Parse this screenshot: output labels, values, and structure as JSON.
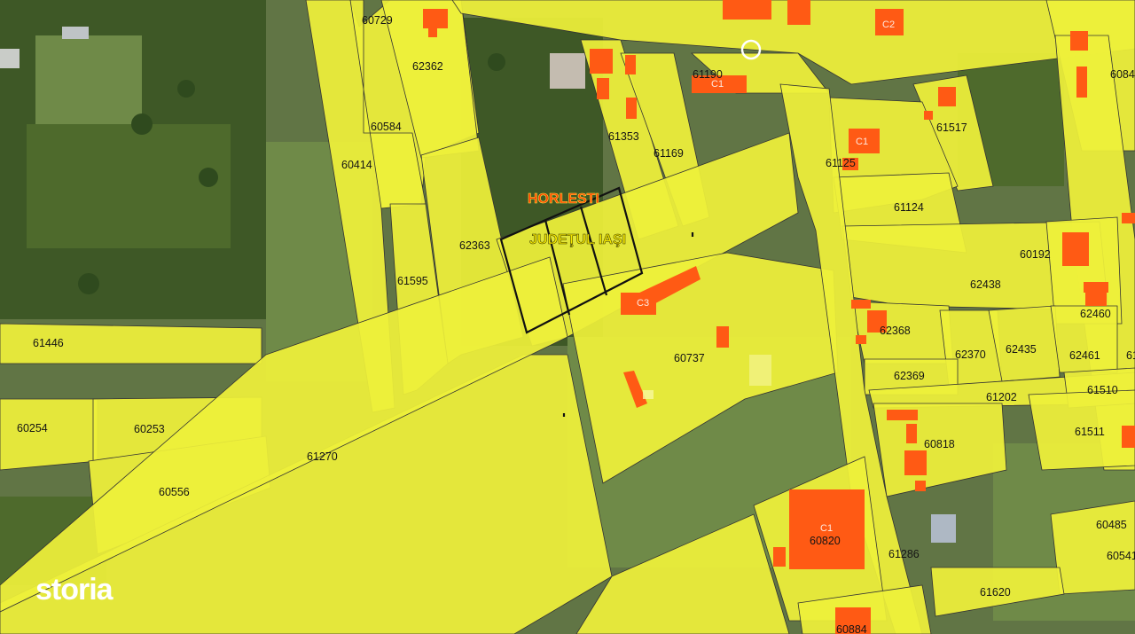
{
  "map": {
    "town_label": "HORLESTI",
    "county_label": "JUDEŢUL IAŞI",
    "parcels": [
      "60729",
      "62362",
      "60584",
      "60414",
      "61353",
      "61169",
      "61190",
      "61517",
      "61125",
      "61124",
      "62363",
      "61595",
      "61446",
      "60192",
      "62438",
      "62460",
      "60737",
      "62368",
      "62370",
      "62435",
      "62461",
      "62369",
      "61202",
      "61510",
      "61511",
      "60818",
      "60254",
      "60253",
      "61270",
      "60556",
      "60820",
      "61286",
      "60485",
      "60541",
      "61620",
      "60884",
      "6084",
      "61"
    ],
    "building_codes": [
      "C1",
      "C2",
      "C1",
      "C3",
      "C1"
    ]
  },
  "branding": {
    "logo_text": "storia"
  }
}
